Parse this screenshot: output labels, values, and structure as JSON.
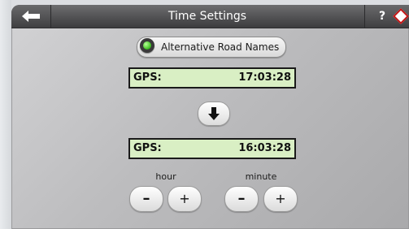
{
  "header": {
    "title": "Time Settings",
    "help_label": "?"
  },
  "toggle": {
    "label": "Alternative Road Names",
    "state": "on",
    "indicator_color": "#49c72a"
  },
  "gps_original": {
    "label": "GPS:",
    "time": "17:03:28"
  },
  "gps_adjusted": {
    "label": "GPS:",
    "time": "16:03:28"
  },
  "adjusters": {
    "hour": {
      "label": "hour",
      "minus": "–",
      "plus": "+"
    },
    "minute": {
      "label": "minute",
      "minus": "–",
      "plus": "+"
    }
  },
  "icons": {
    "back": "arrow-left-icon",
    "convert": "arrow-down-icon",
    "help_badge": "diamond-icon"
  },
  "colors": {
    "display_background": "#d9efc4",
    "titlebar": "#4a4a4c",
    "help_badge": "#c41616"
  }
}
